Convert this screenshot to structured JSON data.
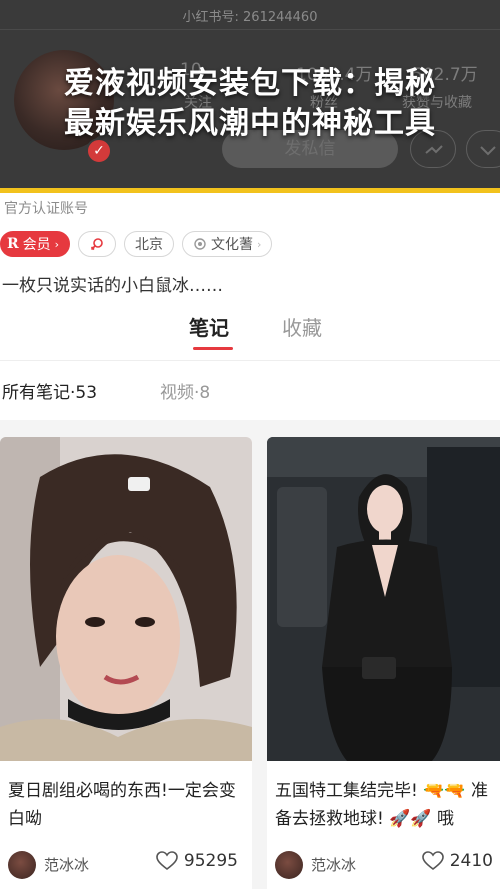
{
  "header": {
    "account_id": "小红书号: 261244460",
    "stats": [
      {
        "value": "10",
        "label": "关注"
      },
      {
        "value": "1002.4万",
        "label": "粉丝"
      },
      {
        "value": "502.7万",
        "label": "获赞与收藏"
      }
    ],
    "follow_label": "发私信",
    "headline_line1": "爱液视频安装包下载：揭秘",
    "headline_line2": "最新娱乐风潮中的神秘工具"
  },
  "profile": {
    "official": "官方认证账号",
    "tags": [
      {
        "label": "会员",
        "icon": "r-member-icon"
      },
      {
        "label": "",
        "icon": "female-icon"
      },
      {
        "label": "北京",
        "icon": ""
      },
      {
        "label": "文化蓍",
        "icon": "badge-icon"
      }
    ],
    "bio": "一枚只说实话的小白鼠冰……"
  },
  "tabs": [
    {
      "label": "笔记",
      "active": true
    },
    {
      "label": "收藏",
      "active": false
    }
  ],
  "subtabs": {
    "all": "所有笔记·53",
    "video": "视频·8"
  },
  "notes": [
    {
      "caption": "夏日剧组必喝的东西!一定会变白呦",
      "author": "范冰冰",
      "likes": "95295"
    },
    {
      "caption": "五国特工集结完毕! 🔫🔫 准备去拯救地球! 🚀🚀 哦",
      "author": "范冰冰",
      "likes": "2410"
    }
  ],
  "colors": {
    "accent": "#e6393f",
    "headline_bar": "#f2c21d"
  }
}
